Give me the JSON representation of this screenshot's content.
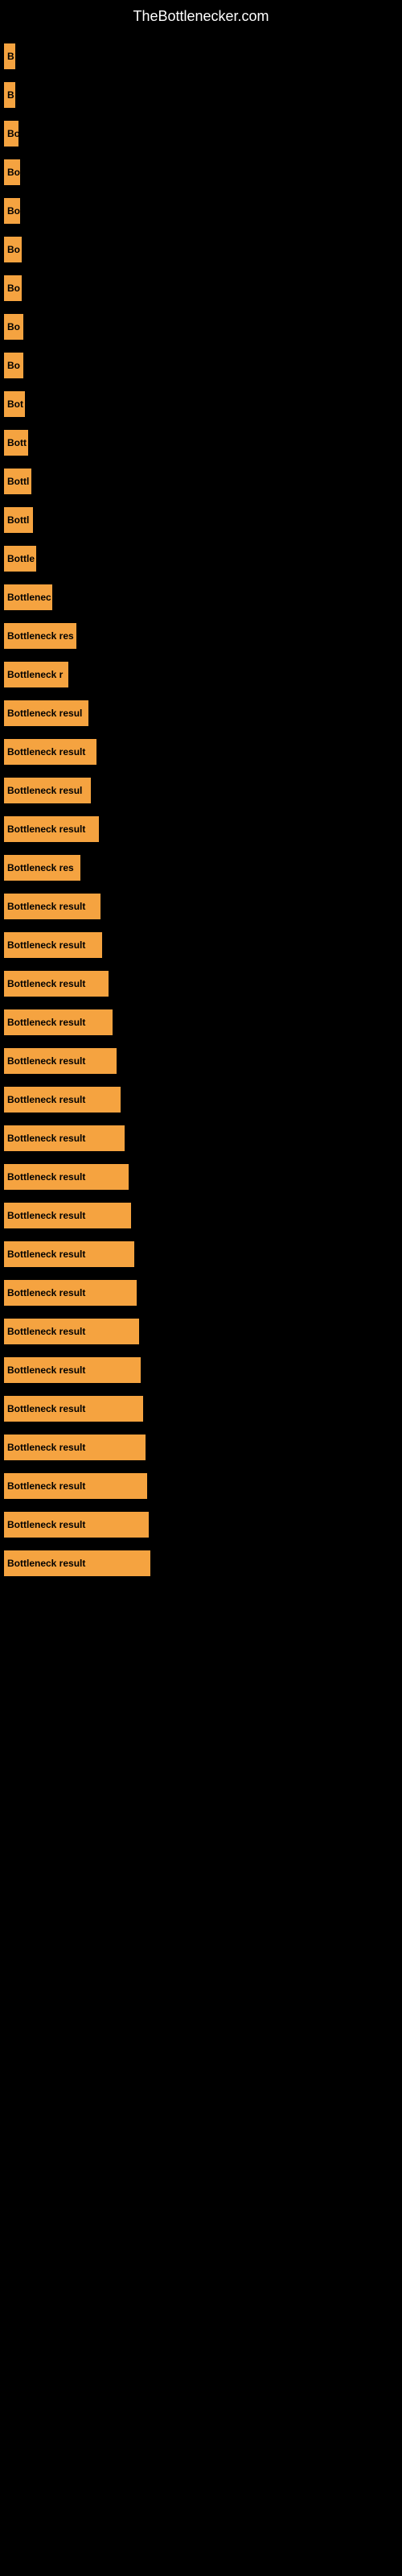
{
  "site": {
    "title": "TheBottlenecker.com"
  },
  "bars": [
    {
      "label": "B",
      "width": 14
    },
    {
      "label": "B",
      "width": 14
    },
    {
      "label": "Bo",
      "width": 18
    },
    {
      "label": "Bo",
      "width": 20
    },
    {
      "label": "Bo",
      "width": 20
    },
    {
      "label": "Bo",
      "width": 22
    },
    {
      "label": "Bo",
      "width": 22
    },
    {
      "label": "Bo",
      "width": 24
    },
    {
      "label": "Bo",
      "width": 24
    },
    {
      "label": "Bot",
      "width": 26
    },
    {
      "label": "Bott",
      "width": 30
    },
    {
      "label": "Bottl",
      "width": 34
    },
    {
      "label": "Bottl",
      "width": 36
    },
    {
      "label": "Bottle",
      "width": 40
    },
    {
      "label": "Bottlenec",
      "width": 60
    },
    {
      "label": "Bottleneck res",
      "width": 90
    },
    {
      "label": "Bottleneck r",
      "width": 80
    },
    {
      "label": "Bottleneck resul",
      "width": 105
    },
    {
      "label": "Bottleneck result",
      "width": 115
    },
    {
      "label": "Bottleneck resul",
      "width": 108
    },
    {
      "label": "Bottleneck result",
      "width": 118
    },
    {
      "label": "Bottleneck res",
      "width": 95
    },
    {
      "label": "Bottleneck result",
      "width": 120
    },
    {
      "label": "Bottleneck result",
      "width": 122
    },
    {
      "label": "Bottleneck result",
      "width": 130
    },
    {
      "label": "Bottleneck result",
      "width": 135
    },
    {
      "label": "Bottleneck result",
      "width": 140
    },
    {
      "label": "Bottleneck result",
      "width": 145
    },
    {
      "label": "Bottleneck result",
      "width": 150
    },
    {
      "label": "Bottleneck result",
      "width": 155
    },
    {
      "label": "Bottleneck result",
      "width": 158
    },
    {
      "label": "Bottleneck result",
      "width": 162
    },
    {
      "label": "Bottleneck result",
      "width": 165
    },
    {
      "label": "Bottleneck result",
      "width": 168
    },
    {
      "label": "Bottleneck result",
      "width": 170
    },
    {
      "label": "Bottleneck result",
      "width": 173
    },
    {
      "label": "Bottleneck result",
      "width": 176
    },
    {
      "label": "Bottleneck result",
      "width": 178
    },
    {
      "label": "Bottleneck result",
      "width": 180
    },
    {
      "label": "Bottleneck result",
      "width": 182
    }
  ]
}
